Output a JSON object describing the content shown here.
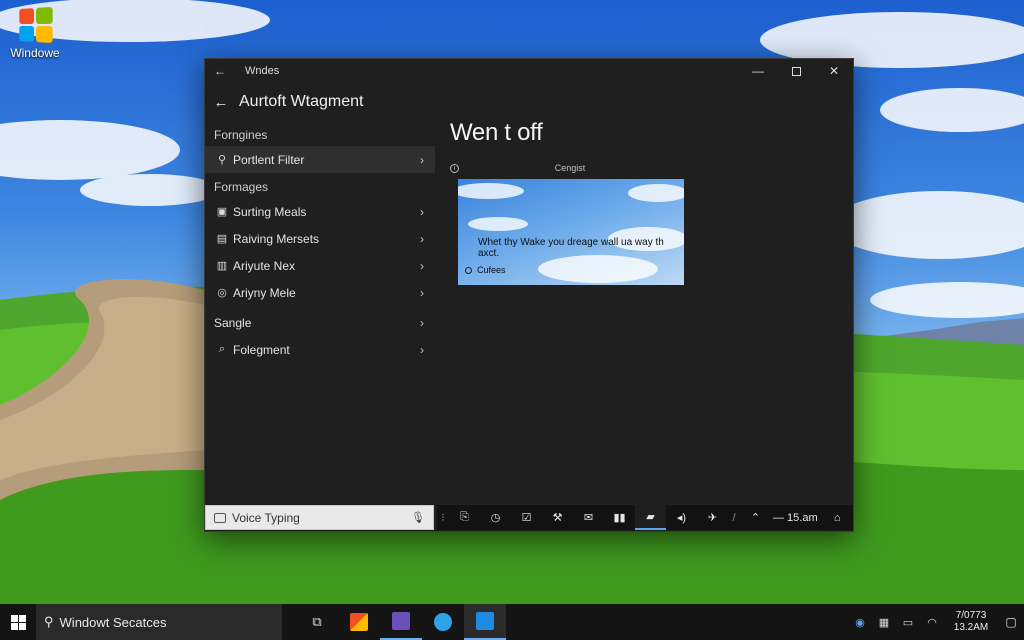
{
  "desktop": {
    "icon_label": "Windowe",
    "logo_colors": [
      "#f25022",
      "#7fba00",
      "#00a4ef",
      "#ffb900"
    ]
  },
  "window": {
    "titlebar": {
      "back_glyph": "←",
      "title": "Wndes",
      "minimize": "—",
      "close": "✕"
    },
    "header": {
      "back_glyph": "←",
      "title": "Aurtoft Wtagment"
    },
    "sidebar": {
      "group1": "Forngines",
      "selected_item": {
        "label": "Portlent Filter",
        "icon": "pin-icon"
      },
      "group2": "Formages",
      "items": [
        {
          "label": "Surting Meals",
          "icon": "image-icon"
        },
        {
          "label": "Raiving Mersets",
          "icon": "photo-icon"
        },
        {
          "label": "Ariyute Nex",
          "icon": "film-icon"
        },
        {
          "label": "Ariyny Mele",
          "icon": "circle-icon"
        }
      ],
      "group3": "Sangle",
      "last_item": {
        "label": "Folegment",
        "icon": "search-icon"
      },
      "chevron": "›"
    },
    "content": {
      "heading": "Wen t off",
      "preview_caption": "Cengist",
      "preview_text": "Whet thy Wake you dreage wall ua way th axct.",
      "preview_option": "Cufees"
    },
    "voice_typing": {
      "label": "Voice Typing"
    },
    "tray": {
      "icons": [
        "more-icon",
        "clipboard-icon",
        "clock-icon",
        "checkbox-icon",
        "wrench-icon",
        "mail-icon",
        "signal-icon",
        "folder-icon",
        "volume-icon",
        "airplane-icon",
        "slash-icon",
        "caret-up-icon"
      ],
      "time": "— 15.am",
      "end_icon": "action-center-icon"
    }
  },
  "taskbar": {
    "search_placeholder": "Windowt Secatces",
    "apps": [
      {
        "name": "task-view",
        "color": "#dddddd"
      },
      {
        "name": "store",
        "color": "#f0a22e"
      },
      {
        "name": "onenote",
        "color": "#6b4fbb"
      },
      {
        "name": "edge",
        "color": "#2ea3e8"
      },
      {
        "name": "photos",
        "color": "#1f8be0"
      }
    ],
    "tray": {
      "time": "7/0773",
      "date": "13.2AM"
    }
  }
}
